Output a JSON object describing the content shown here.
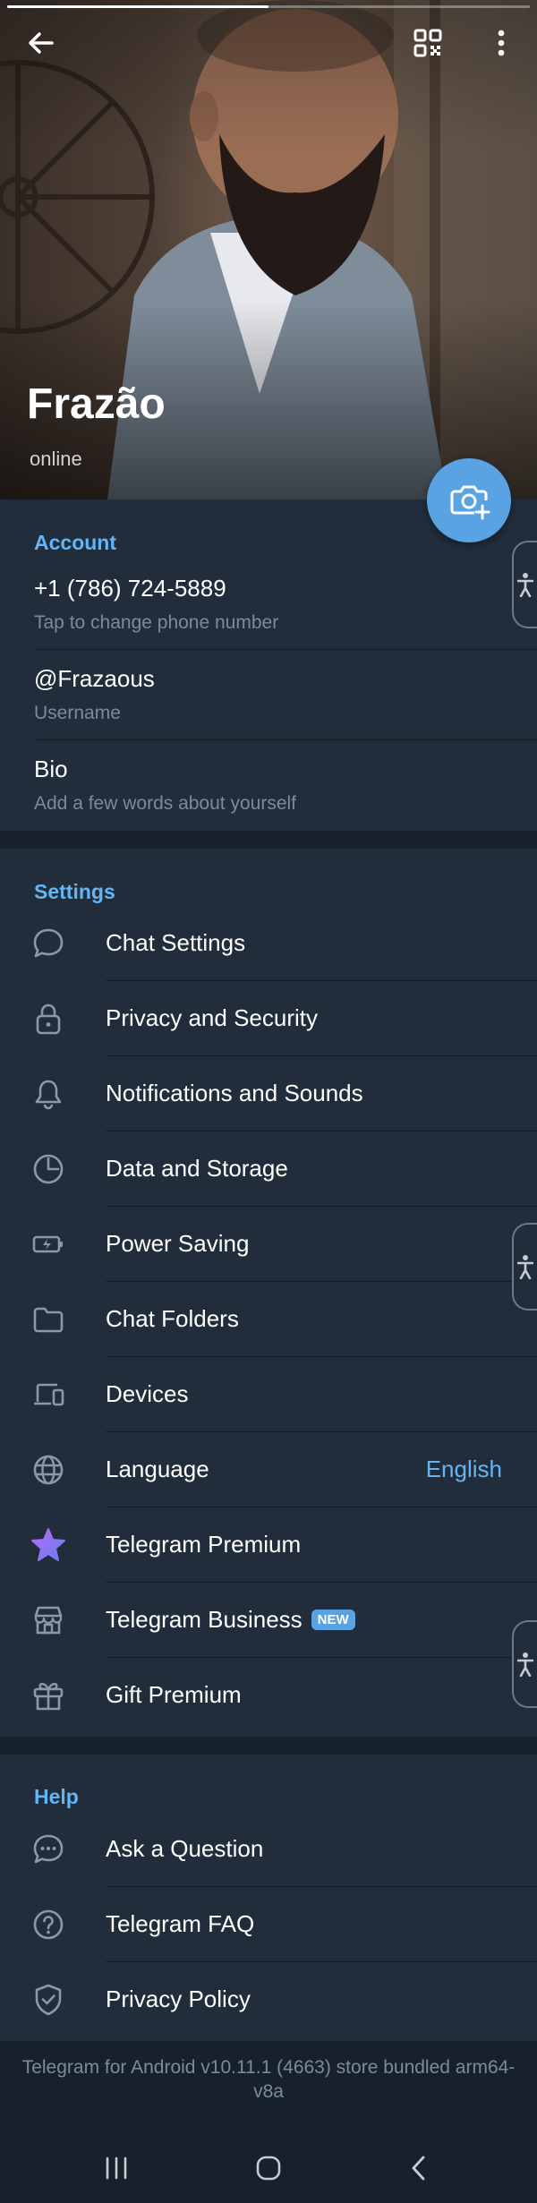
{
  "header": {
    "name": "Frazão",
    "status": "online",
    "progress": 0.5,
    "icons": {
      "back": "back-arrow-icon",
      "qr": "qr-code-icon",
      "menu": "more-vertical-icon",
      "camera": "camera-add-icon"
    }
  },
  "account": {
    "title": "Account",
    "phone": "+1 (786) 724-5889",
    "phone_hint": "Tap to change phone number",
    "username": "@Frazaous",
    "username_hint": "Username",
    "bio": "Bio",
    "bio_hint": "Add a few words about yourself"
  },
  "settings": {
    "title": "Settings",
    "items": [
      {
        "label": "Chat Settings",
        "icon": "chat-bubble-icon"
      },
      {
        "label": "Privacy and Security",
        "icon": "lock-icon"
      },
      {
        "label": "Notifications and Sounds",
        "icon": "bell-icon"
      },
      {
        "label": "Data and Storage",
        "icon": "pie-chart-icon"
      },
      {
        "label": "Power Saving",
        "icon": "battery-icon"
      },
      {
        "label": "Chat Folders",
        "icon": "folder-icon"
      },
      {
        "label": "Devices",
        "icon": "devices-icon"
      },
      {
        "label": "Language",
        "icon": "globe-icon",
        "value": "English"
      },
      {
        "label": "Telegram Premium",
        "icon": "premium-star-icon"
      },
      {
        "label": "Telegram Business",
        "icon": "store-icon",
        "badge": "NEW"
      },
      {
        "label": "Gift Premium",
        "icon": "gift-icon"
      }
    ]
  },
  "help": {
    "title": "Help",
    "items": [
      {
        "label": "Ask a Question",
        "icon": "chat-dots-icon"
      },
      {
        "label": "Telegram FAQ",
        "icon": "question-circle-icon"
      },
      {
        "label": "Privacy Policy",
        "icon": "shield-check-icon"
      }
    ]
  },
  "footer": {
    "version": "Telegram for Android v10.11.1 (4663) store bundled arm64-v8a"
  },
  "colors": {
    "accent": "#64b5f6",
    "background": "#212d3b",
    "separator": "#17212b",
    "hint": "#7d8b99",
    "premium_gradient": [
      "#b36cf0",
      "#6a7cf5"
    ]
  }
}
